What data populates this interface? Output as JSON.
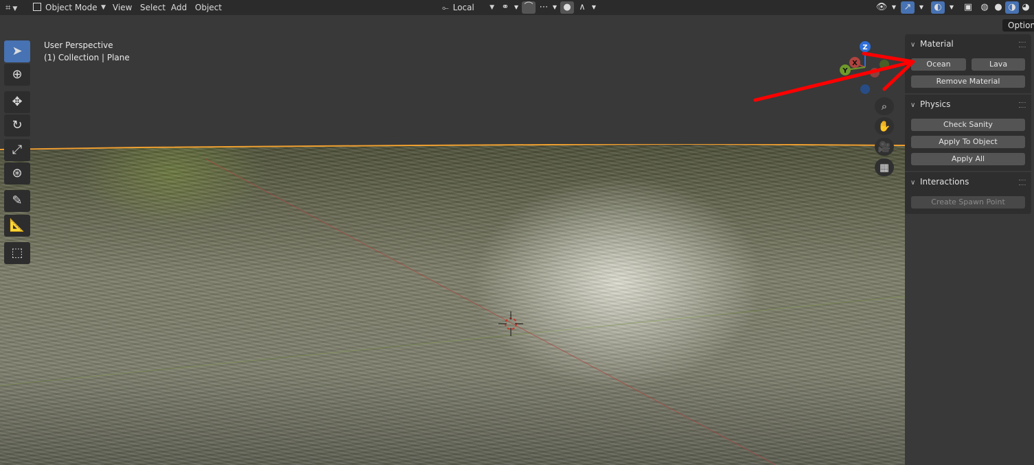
{
  "header": {
    "editor_type_icon": "camera-grid-icon",
    "mode_label": "Object Mode",
    "menus": [
      "View",
      "Select",
      "Add",
      "Object"
    ],
    "orientation_label": "Local"
  },
  "viewport": {
    "perspective_label": "User Perspective",
    "collection_label": "(1) Collection | Plane"
  },
  "gizmo": {
    "z_label": "Z",
    "x_label": "X",
    "y_label": "Y"
  },
  "sidebar": {
    "options_label": "Options",
    "material": {
      "title": "Material",
      "ocean_label": "Ocean",
      "lava_label": "Lava",
      "remove_label": "Remove Material"
    },
    "physics": {
      "title": "Physics",
      "check_label": "Check Sanity",
      "apply_object_label": "Apply To Object",
      "apply_all_label": "Apply All"
    },
    "interactions": {
      "title": "Interactions",
      "spawn_label": "Create Spawn Point"
    }
  },
  "colors": {
    "accent": "#4772b3",
    "annotation_arrow": "#ff0000",
    "selection_outline": "#f0a030",
    "x_axis": "#b0443f",
    "y_axis": "#6f9a2a",
    "z_axis": "#2f6fd9"
  }
}
